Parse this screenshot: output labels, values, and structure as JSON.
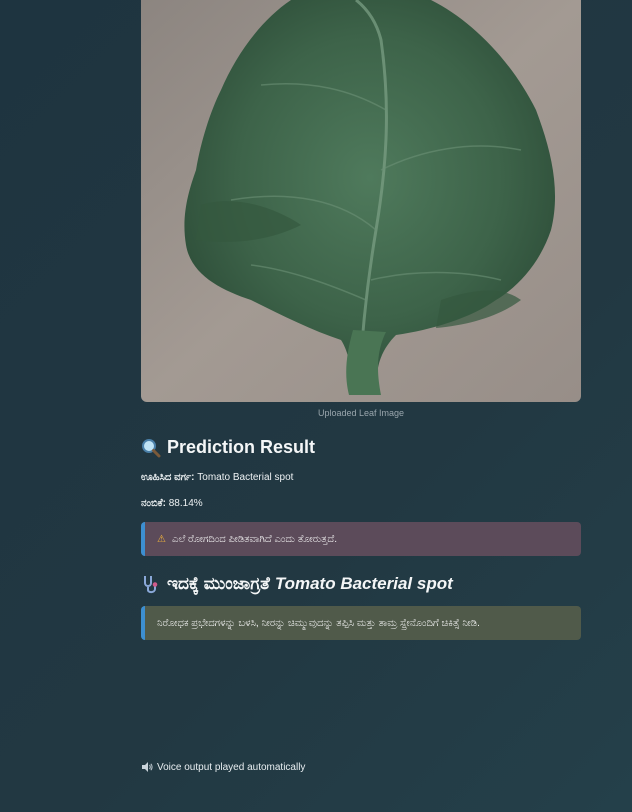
{
  "image": {
    "caption": "Uploaded Leaf Image",
    "alt": "Tomato leaf photo"
  },
  "prediction": {
    "heading_icon": "magnifier-icon",
    "heading": "Prediction Result",
    "class_label": "ಊಹಿಸಿದ ವರ್ಗ:",
    "class_value": "Tomato Bacterial spot",
    "confidence_label": "ನಂಬಿಕೆ:",
    "confidence_value": "88.14%"
  },
  "warning": {
    "icon": "warning-icon",
    "text": "ಎಲೆ ರೋಗದಿಂದ ಪೀಡಿತವಾಗಿದೆ ಎಂದು ತೋರುತ್ತದೆ."
  },
  "precaution": {
    "heading_icon": "stethoscope-icon",
    "heading_prefix": "ಇದಕ್ಕೆ ಮುಂಜಾಗ್ರತೆ",
    "heading_disease": "Tomato Bacterial spot",
    "text": "ನಿರೋಧಕ ಪ್ರಭೇದಗಳನ್ನು ಬಳಸಿ, ನೀರನ್ನು ಚಿಮ್ಮುವುದನ್ನು ತಪ್ಪಿಸಿ ಮತ್ತು ತಾಮ್ರ ಸ್ಪ್ರೇನೊಂದಿಗೆ ಚಿಕಿತ್ಸೆ ನೀಡಿ."
  },
  "voice": {
    "icon": "speaker-icon",
    "text": "Voice output played automatically"
  },
  "colors": {
    "warning_bg": "#5c4b5a",
    "info_bg": "#505a4a",
    "accent_bar": "#3d8fd1"
  }
}
